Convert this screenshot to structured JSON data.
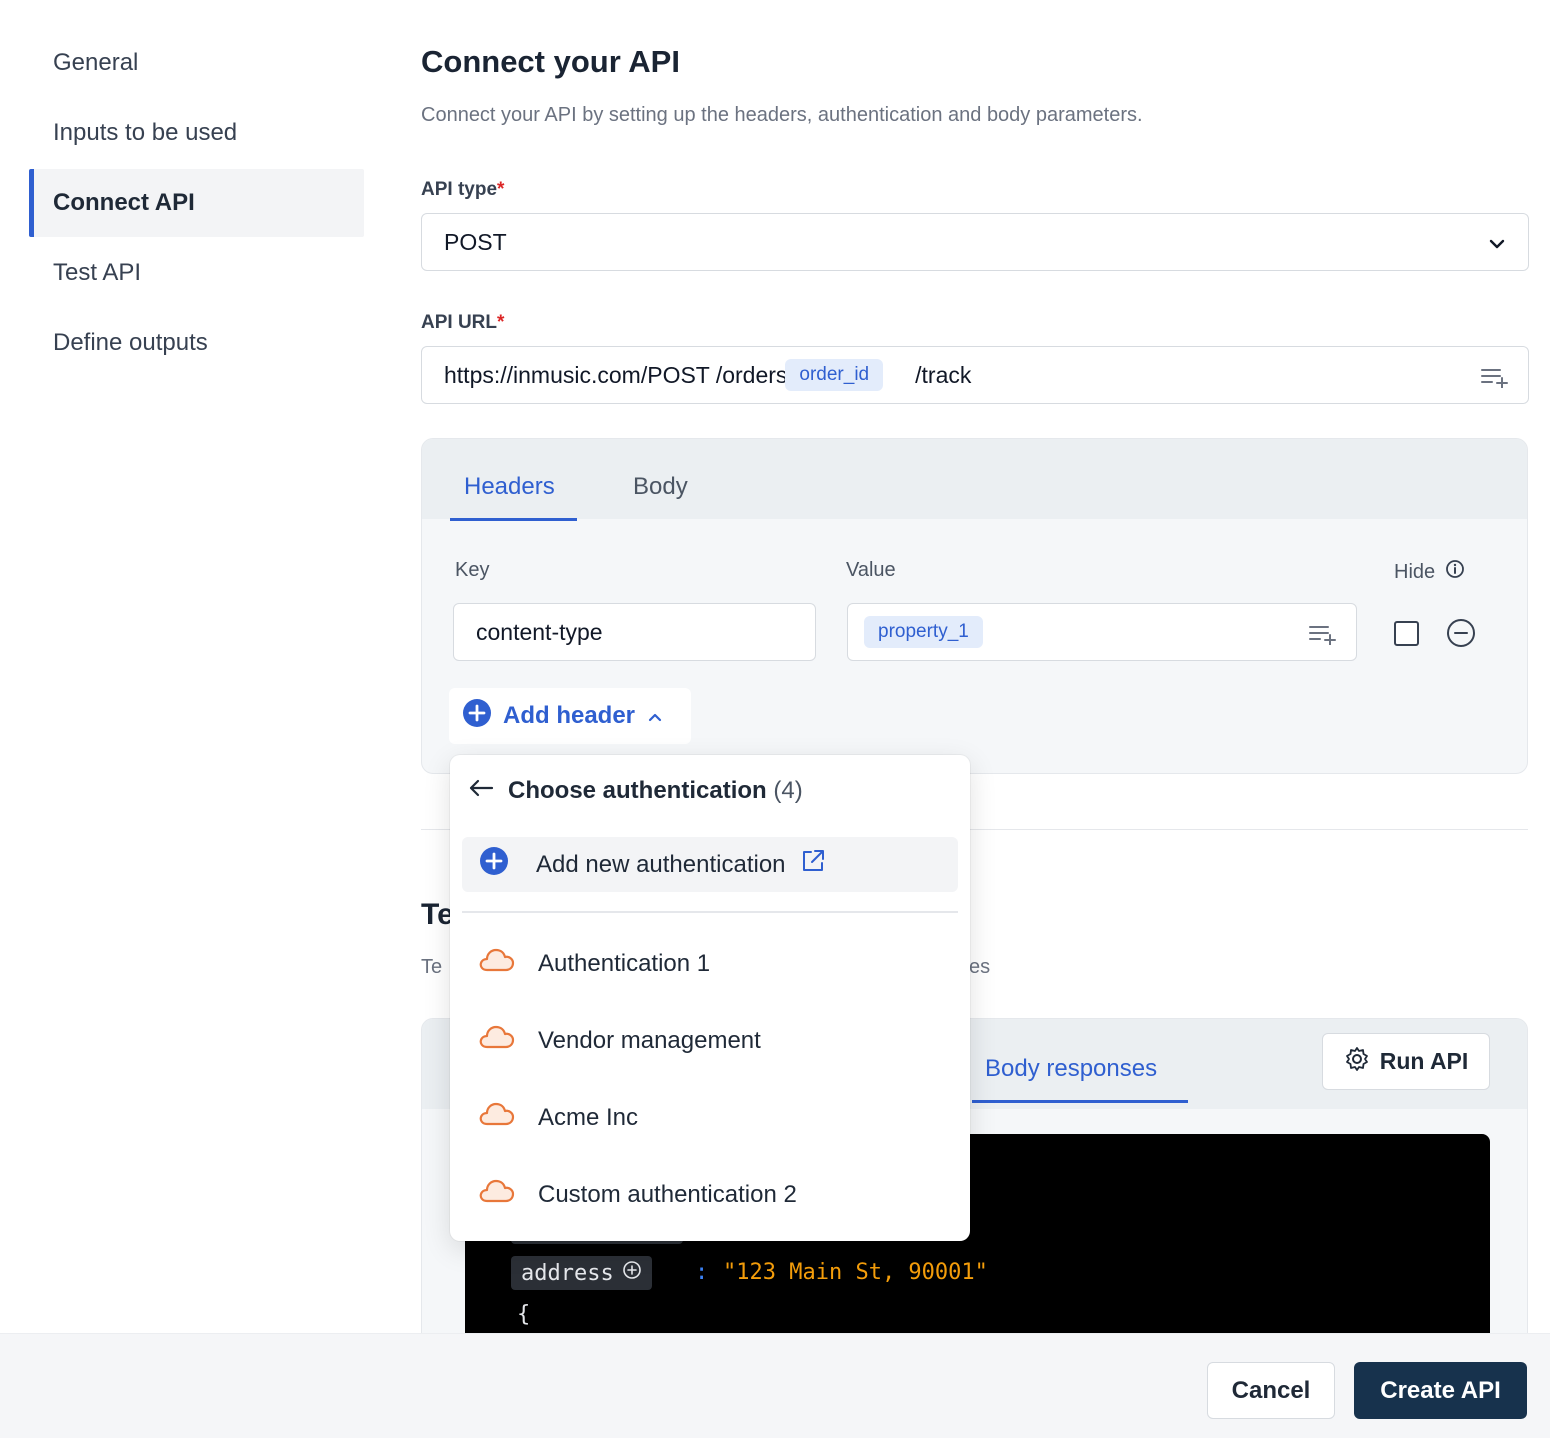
{
  "sidebar": {
    "items": [
      {
        "label": "General"
      },
      {
        "label": "Inputs to be used"
      },
      {
        "label": "Connect API",
        "active": true
      },
      {
        "label": "Test API"
      },
      {
        "label": "Define outputs"
      }
    ]
  },
  "main": {
    "title": "Connect your API",
    "subtitle": "Connect your API by setting up the headers, authentication and body parameters.",
    "api_type": {
      "label": "API type",
      "required_mark": "*",
      "value": "POST"
    },
    "api_url": {
      "label": "API URL",
      "required_mark": "*",
      "prefix": "https://inmusic.com/POST /orders",
      "variable": "order_id",
      "suffix": "/track"
    }
  },
  "headers_panel": {
    "tabs": [
      {
        "label": "Headers",
        "active": true
      },
      {
        "label": "Body"
      }
    ],
    "columns": {
      "key": "Key",
      "value": "Value",
      "hide": "Hide"
    },
    "row": {
      "key": "content-type",
      "value_variable": "property_1",
      "hidden": false
    },
    "add_header_label": "Add header"
  },
  "test_section": {
    "title_visible": "Te",
    "subtitle_visible_start": "Te",
    "subtitle_visible_end": "es",
    "tab_active": "Body responses",
    "run_label": "Run API",
    "code": {
      "key": "address",
      "colon": ":",
      "value": "\"123 Main St, 90001\"",
      "brace": "{"
    }
  },
  "dropdown": {
    "title": "Choose authentication",
    "count": "(4)",
    "add_label": "Add new authentication",
    "items": [
      {
        "label": "Authentication 1"
      },
      {
        "label": "Vendor management"
      },
      {
        "label": "Acme Inc"
      },
      {
        "label": "Custom authentication 2"
      }
    ]
  },
  "footer": {
    "cancel_label": "Cancel",
    "create_label": "Create API"
  },
  "colors": {
    "accent": "#2f5fd0",
    "primary_button": "#17324d",
    "auth_icon": "#e8773a",
    "required": "#dc2626"
  }
}
